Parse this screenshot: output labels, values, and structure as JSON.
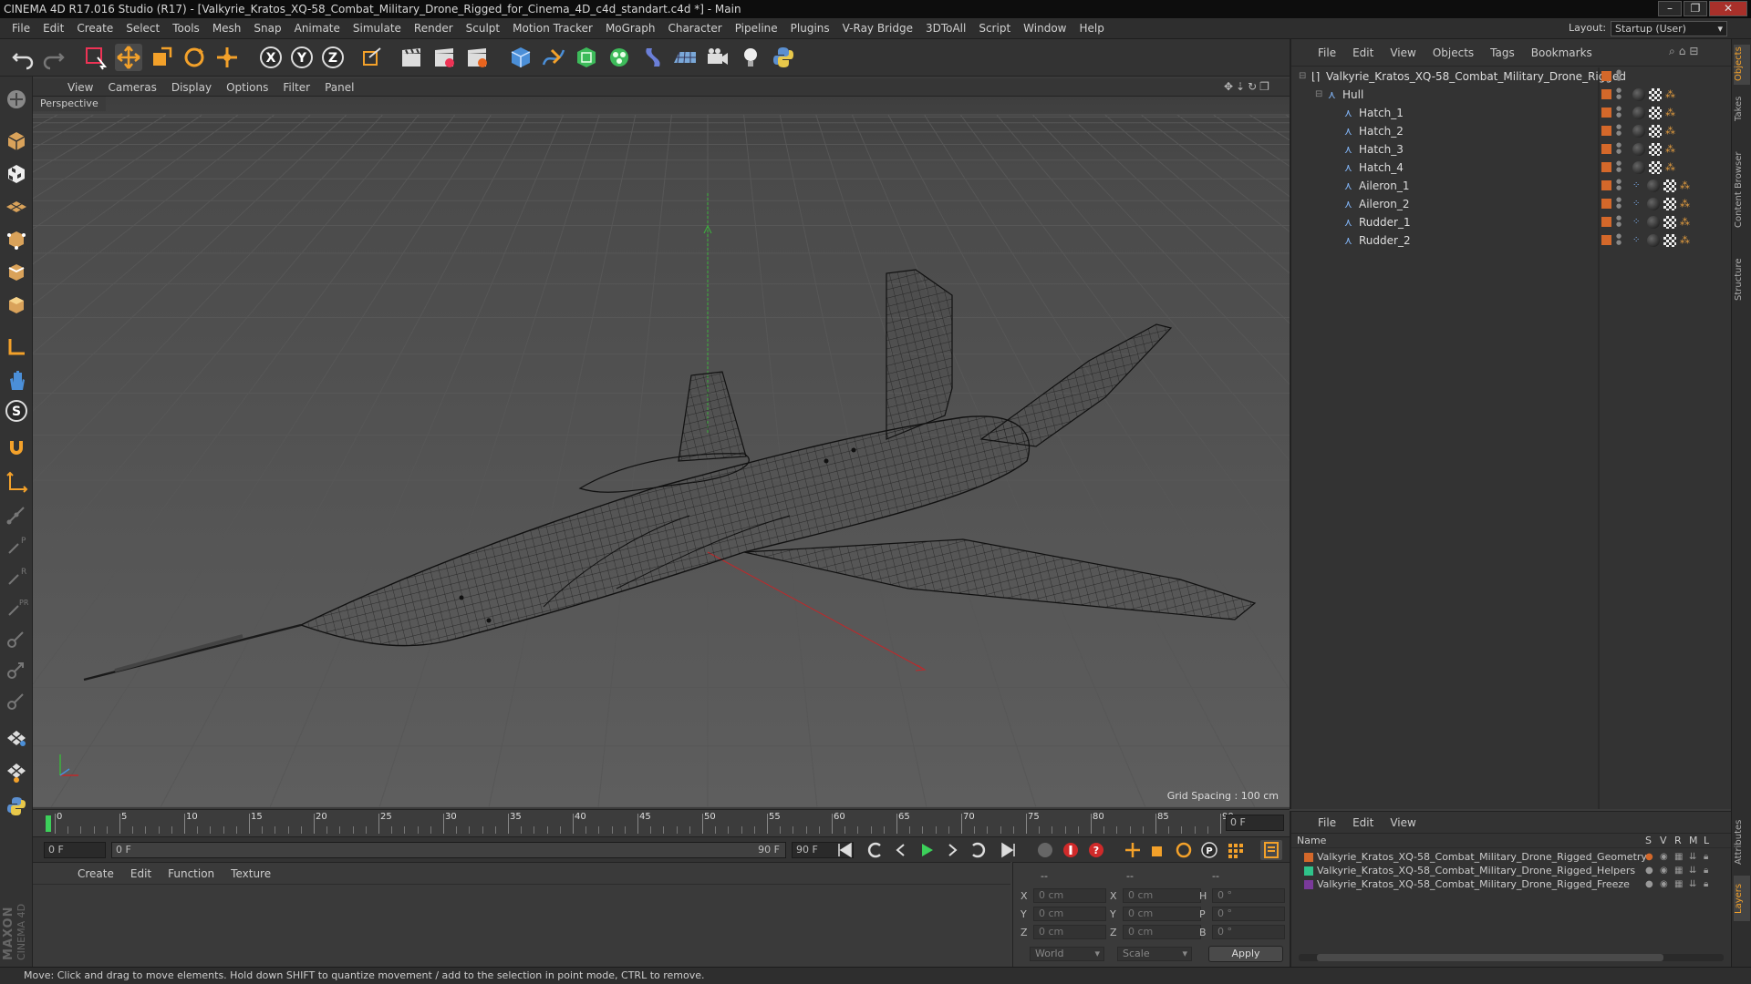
{
  "window": {
    "title": "CINEMA 4D R17.016 Studio (R17) - [Valkyrie_Kratos_XQ-58_Combat_Military_Drone_Rigged_for_Cinema_4D_c4d_standart.c4d *] - Main",
    "controls": [
      "–",
      "❐",
      "✕"
    ]
  },
  "menu": [
    "File",
    "Edit",
    "Create",
    "Select",
    "Tools",
    "Mesh",
    "Snap",
    "Animate",
    "Simulate",
    "Render",
    "Sculpt",
    "Motion Tracker",
    "MoGraph",
    "Character",
    "Pipeline",
    "Plugins",
    "V-Ray Bridge",
    "3DToAll",
    "Script",
    "Window",
    "Help"
  ],
  "layout": {
    "label": "Layout:",
    "value": "Startup (User)"
  },
  "viewport": {
    "menu": [
      "View",
      "Cameras",
      "Display",
      "Options",
      "Filter",
      "Panel"
    ],
    "label": "Perspective",
    "grid_spacing": "Grid Spacing : 100 cm"
  },
  "timeline": {
    "ticks": [
      "0",
      "5",
      "10",
      "15",
      "20",
      "25",
      "30",
      "35",
      "40",
      "45",
      "50",
      "55",
      "60",
      "65",
      "70",
      "75",
      "80",
      "85",
      "90"
    ],
    "current_frame": "0 F",
    "start_frame": "0 F",
    "range_start": "0 F",
    "range_end": "90 F",
    "end_frame": "90 F"
  },
  "material_panel": {
    "menu": [
      "Create",
      "Edit",
      "Function",
      "Texture"
    ]
  },
  "coordinates": {
    "header": [
      "--",
      "--",
      "--"
    ],
    "rows": [
      {
        "a": "X",
        "av": "0 cm",
        "b": "X",
        "bv": "0 cm",
        "c": "H",
        "cv": "0 °"
      },
      {
        "a": "Y",
        "av": "0 cm",
        "b": "Y",
        "bv": "0 cm",
        "c": "P",
        "cv": "0 °"
      },
      {
        "a": "Z",
        "av": "0 cm",
        "b": "Z",
        "bv": "0 cm",
        "c": "B",
        "cv": "0 °"
      }
    ],
    "mode": "World",
    "scale": "Scale",
    "apply": "Apply"
  },
  "object_manager": {
    "menu": [
      "File",
      "Edit",
      "View",
      "Objects",
      "Tags",
      "Bookmarks"
    ],
    "objects": [
      {
        "name": "Valkyrie_Kratos_XQ-58_Combat_Military_Drone_Rigged",
        "level": 0
      },
      {
        "name": "Hull",
        "level": 1
      },
      {
        "name": "Hatch_1",
        "level": 2
      },
      {
        "name": "Hatch_2",
        "level": 2
      },
      {
        "name": "Hatch_3",
        "level": 2
      },
      {
        "name": "Hatch_4",
        "level": 2
      },
      {
        "name": "Aileron_1",
        "level": 2
      },
      {
        "name": "Aileron_2",
        "level": 2
      },
      {
        "name": "Rudder_1",
        "level": 2
      },
      {
        "name": "Rudder_2",
        "level": 2
      }
    ]
  },
  "layer_manager": {
    "menu": [
      "File",
      "Edit",
      "View"
    ],
    "columns": [
      "Name",
      "S",
      "V",
      "R",
      "M",
      "L"
    ],
    "layers": [
      {
        "name": "Valkyrie_Kratos_XQ-58_Combat_Military_Drone_Rigged_Geometry",
        "color": "#d4682a"
      },
      {
        "name": "Valkyrie_Kratos_XQ-58_Combat_Military_Drone_Rigged_Helpers",
        "color": "#2fc38a"
      },
      {
        "name": "Valkyrie_Kratos_XQ-58_Combat_Military_Drone_Rigged_Freeze",
        "color": "#7a3a9a"
      }
    ]
  },
  "right_tabs": [
    "Objects",
    "Takes",
    "Content Browser",
    "Structure",
    "Attributes",
    "Layers"
  ],
  "brand": [
    "MAXON",
    "CINEMA 4D"
  ],
  "status": "Move: Click and drag to move elements. Hold down SHIFT to quantize movement / add to the selection in point mode, CTRL to remove.",
  "colors": {
    "accent": "#5a9be0",
    "orange": "#d4682a",
    "x_axis": "#c0282a",
    "y_axis": "#3cb33c"
  }
}
